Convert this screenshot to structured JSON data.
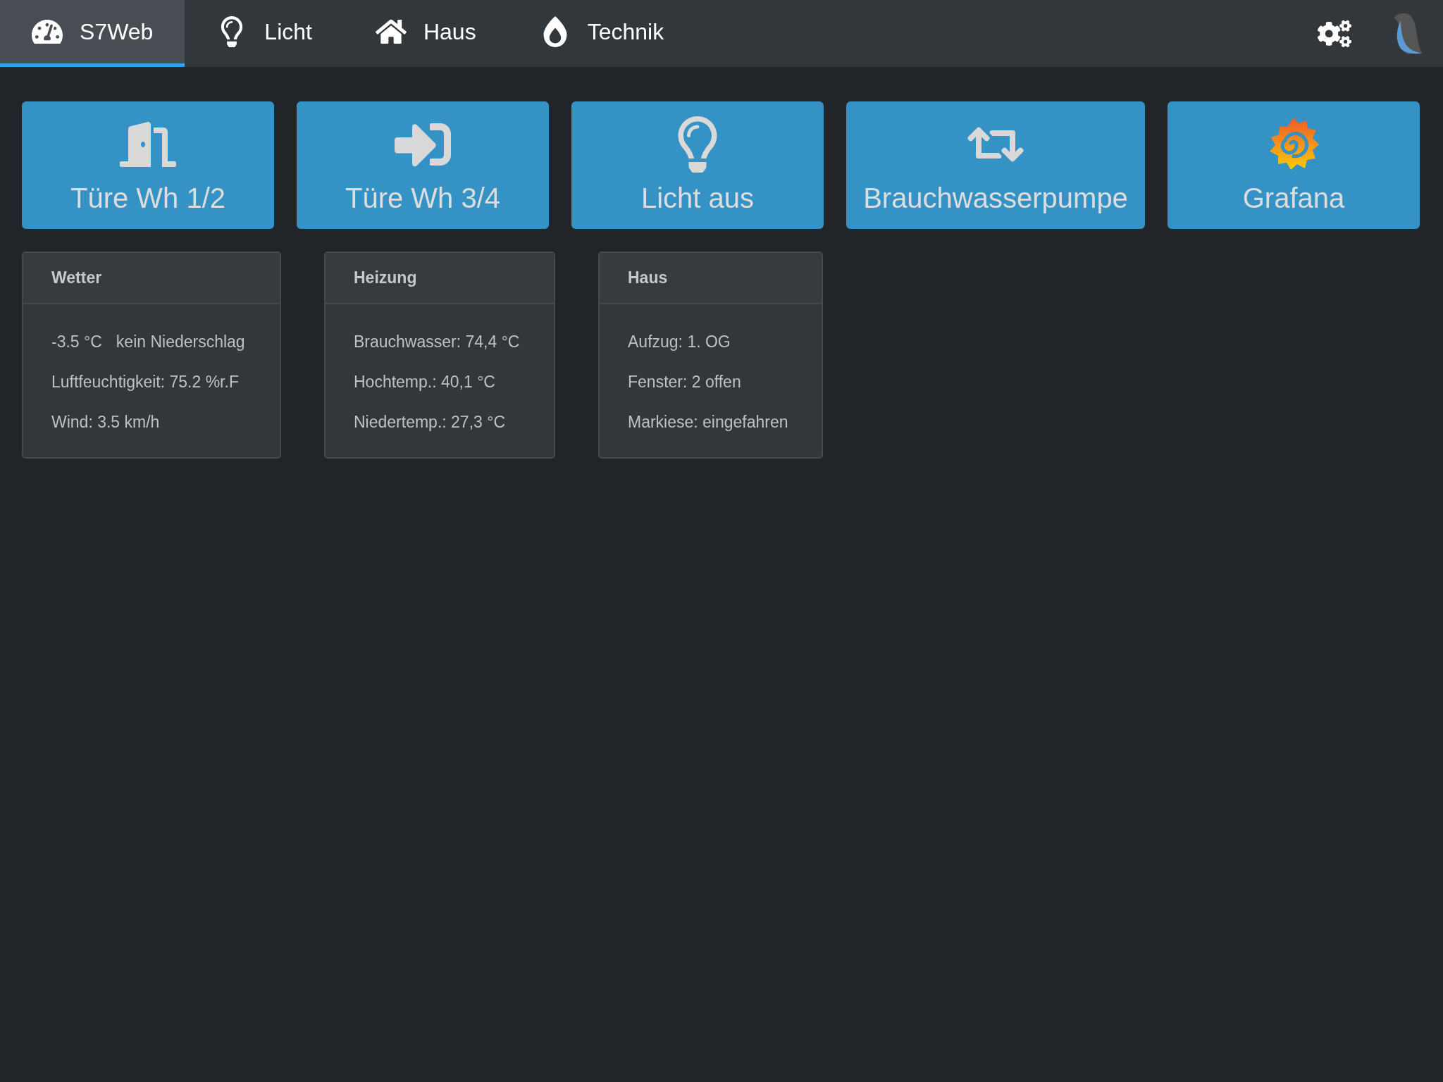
{
  "nav": {
    "tabs": [
      {
        "label": "S7Web",
        "selected": true
      },
      {
        "label": "Licht",
        "selected": false
      },
      {
        "label": "Haus",
        "selected": false
      },
      {
        "label": "Technik",
        "selected": false
      }
    ]
  },
  "tiles": [
    {
      "label": "Türe Wh 1/2"
    },
    {
      "label": "Türe Wh 3/4"
    },
    {
      "label": "Licht aus"
    },
    {
      "label": "Brauchwasserpumpe"
    },
    {
      "label": "Grafana"
    }
  ],
  "panels": [
    {
      "title": "Wetter",
      "lines": [
        [
          "-3.5 °C",
          "kein Niederschlag"
        ],
        [
          "Luftfeuchtigkeit: 75.2 %r.F"
        ],
        [
          "Wind: 3.5 km/h"
        ]
      ]
    },
    {
      "title": "Heizung",
      "lines": [
        [
          "Brauchwasser: 74,4 °C"
        ],
        [
          "Hochtemp.: 40,1 °C"
        ],
        [
          "Niedertemp.: 27,3 °C"
        ]
      ]
    },
    {
      "title": "Haus",
      "lines": [
        [
          "Aufzug: 1. OG"
        ],
        [
          "Fenster: 2 offen"
        ],
        [
          "Markiese: eingefahren"
        ]
      ]
    }
  ]
}
